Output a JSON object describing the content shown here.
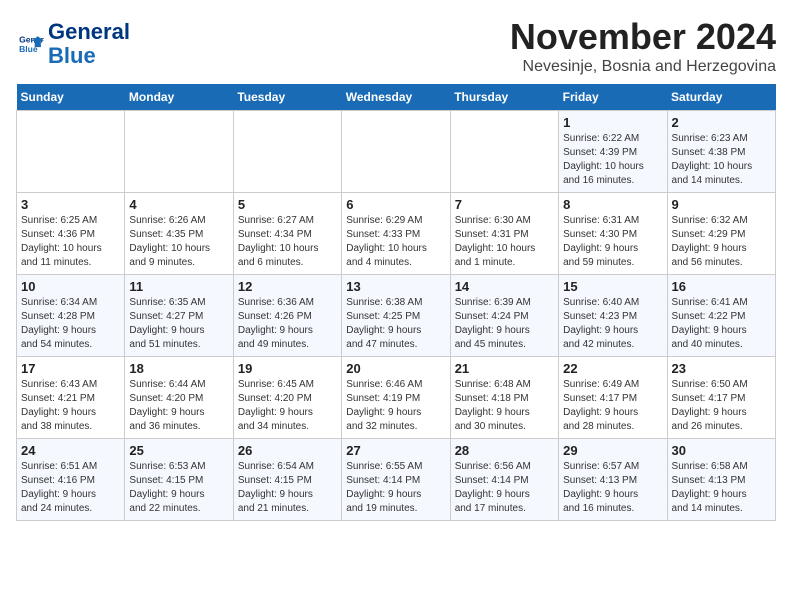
{
  "header": {
    "logo_line1": "General",
    "logo_line2": "Blue",
    "month_title": "November 2024",
    "location": "Nevesinje, Bosnia and Herzegovina"
  },
  "weekdays": [
    "Sunday",
    "Monday",
    "Tuesday",
    "Wednesday",
    "Thursday",
    "Friday",
    "Saturday"
  ],
  "weeks": [
    [
      {
        "day": "",
        "info": ""
      },
      {
        "day": "",
        "info": ""
      },
      {
        "day": "",
        "info": ""
      },
      {
        "day": "",
        "info": ""
      },
      {
        "day": "",
        "info": ""
      },
      {
        "day": "1",
        "info": "Sunrise: 6:22 AM\nSunset: 4:39 PM\nDaylight: 10 hours\nand 16 minutes."
      },
      {
        "day": "2",
        "info": "Sunrise: 6:23 AM\nSunset: 4:38 PM\nDaylight: 10 hours\nand 14 minutes."
      }
    ],
    [
      {
        "day": "3",
        "info": "Sunrise: 6:25 AM\nSunset: 4:36 PM\nDaylight: 10 hours\nand 11 minutes."
      },
      {
        "day": "4",
        "info": "Sunrise: 6:26 AM\nSunset: 4:35 PM\nDaylight: 10 hours\nand 9 minutes."
      },
      {
        "day": "5",
        "info": "Sunrise: 6:27 AM\nSunset: 4:34 PM\nDaylight: 10 hours\nand 6 minutes."
      },
      {
        "day": "6",
        "info": "Sunrise: 6:29 AM\nSunset: 4:33 PM\nDaylight: 10 hours\nand 4 minutes."
      },
      {
        "day": "7",
        "info": "Sunrise: 6:30 AM\nSunset: 4:31 PM\nDaylight: 10 hours\nand 1 minute."
      },
      {
        "day": "8",
        "info": "Sunrise: 6:31 AM\nSunset: 4:30 PM\nDaylight: 9 hours\nand 59 minutes."
      },
      {
        "day": "9",
        "info": "Sunrise: 6:32 AM\nSunset: 4:29 PM\nDaylight: 9 hours\nand 56 minutes."
      }
    ],
    [
      {
        "day": "10",
        "info": "Sunrise: 6:34 AM\nSunset: 4:28 PM\nDaylight: 9 hours\nand 54 minutes."
      },
      {
        "day": "11",
        "info": "Sunrise: 6:35 AM\nSunset: 4:27 PM\nDaylight: 9 hours\nand 51 minutes."
      },
      {
        "day": "12",
        "info": "Sunrise: 6:36 AM\nSunset: 4:26 PM\nDaylight: 9 hours\nand 49 minutes."
      },
      {
        "day": "13",
        "info": "Sunrise: 6:38 AM\nSunset: 4:25 PM\nDaylight: 9 hours\nand 47 minutes."
      },
      {
        "day": "14",
        "info": "Sunrise: 6:39 AM\nSunset: 4:24 PM\nDaylight: 9 hours\nand 45 minutes."
      },
      {
        "day": "15",
        "info": "Sunrise: 6:40 AM\nSunset: 4:23 PM\nDaylight: 9 hours\nand 42 minutes."
      },
      {
        "day": "16",
        "info": "Sunrise: 6:41 AM\nSunset: 4:22 PM\nDaylight: 9 hours\nand 40 minutes."
      }
    ],
    [
      {
        "day": "17",
        "info": "Sunrise: 6:43 AM\nSunset: 4:21 PM\nDaylight: 9 hours\nand 38 minutes."
      },
      {
        "day": "18",
        "info": "Sunrise: 6:44 AM\nSunset: 4:20 PM\nDaylight: 9 hours\nand 36 minutes."
      },
      {
        "day": "19",
        "info": "Sunrise: 6:45 AM\nSunset: 4:20 PM\nDaylight: 9 hours\nand 34 minutes."
      },
      {
        "day": "20",
        "info": "Sunrise: 6:46 AM\nSunset: 4:19 PM\nDaylight: 9 hours\nand 32 minutes."
      },
      {
        "day": "21",
        "info": "Sunrise: 6:48 AM\nSunset: 4:18 PM\nDaylight: 9 hours\nand 30 minutes."
      },
      {
        "day": "22",
        "info": "Sunrise: 6:49 AM\nSunset: 4:17 PM\nDaylight: 9 hours\nand 28 minutes."
      },
      {
        "day": "23",
        "info": "Sunrise: 6:50 AM\nSunset: 4:17 PM\nDaylight: 9 hours\nand 26 minutes."
      }
    ],
    [
      {
        "day": "24",
        "info": "Sunrise: 6:51 AM\nSunset: 4:16 PM\nDaylight: 9 hours\nand 24 minutes."
      },
      {
        "day": "25",
        "info": "Sunrise: 6:53 AM\nSunset: 4:15 PM\nDaylight: 9 hours\nand 22 minutes."
      },
      {
        "day": "26",
        "info": "Sunrise: 6:54 AM\nSunset: 4:15 PM\nDaylight: 9 hours\nand 21 minutes."
      },
      {
        "day": "27",
        "info": "Sunrise: 6:55 AM\nSunset: 4:14 PM\nDaylight: 9 hours\nand 19 minutes."
      },
      {
        "day": "28",
        "info": "Sunrise: 6:56 AM\nSunset: 4:14 PM\nDaylight: 9 hours\nand 17 minutes."
      },
      {
        "day": "29",
        "info": "Sunrise: 6:57 AM\nSunset: 4:13 PM\nDaylight: 9 hours\nand 16 minutes."
      },
      {
        "day": "30",
        "info": "Sunrise: 6:58 AM\nSunset: 4:13 PM\nDaylight: 9 hours\nand 14 minutes."
      }
    ]
  ]
}
